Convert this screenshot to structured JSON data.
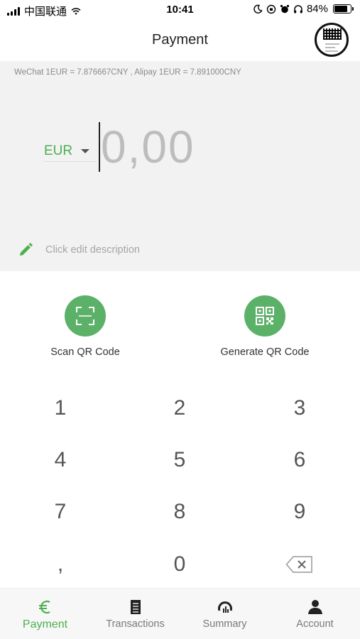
{
  "status_bar": {
    "carrier": "中国联通",
    "time": "10:41",
    "battery": "84%",
    "battery_level": 0.84
  },
  "header": {
    "title": "Payment",
    "qr_thumbnail_icon": "qr-code-thumbnail"
  },
  "amount_panel": {
    "exchange_rate": "WeChat 1EUR = 7.876667CNY , Alipay 1EUR = 7.891000CNY",
    "currency": "EUR",
    "amount": "0,00",
    "description_placeholder": "Click edit description",
    "edit_icon": "pencil-icon"
  },
  "actions": [
    {
      "label": "Scan QR Code",
      "icon": "scan-frame-icon"
    },
    {
      "label": "Generate QR Code",
      "icon": "qr-code-icon"
    }
  ],
  "keypad": {
    "keys": [
      "1",
      "2",
      "3",
      "4",
      "5",
      "6",
      "7",
      "8",
      "9",
      ",",
      "0"
    ],
    "backspace_icon": "backspace-icon"
  },
  "bottom_nav": [
    {
      "label": "Payment",
      "icon": "euro-icon",
      "active": true
    },
    {
      "label": "Transactions",
      "icon": "receipt-icon",
      "active": false
    },
    {
      "label": "Summary",
      "icon": "chart-gauge-icon",
      "active": false
    },
    {
      "label": "Account",
      "icon": "user-icon",
      "active": false
    }
  ],
  "colors": {
    "accent": "#4caf50",
    "action_button": "#5cb168",
    "panel_background": "#f2f2f2",
    "placeholder_text": "#bdbdbd"
  }
}
